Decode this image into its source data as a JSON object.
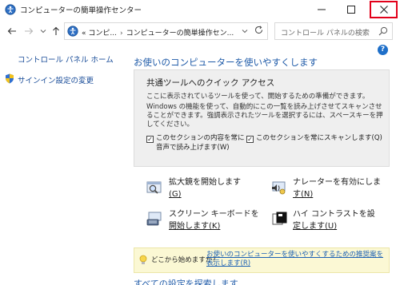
{
  "window": {
    "title": "コンピューターの簡単操作センター",
    "minimize_glyph": "—",
    "close_glyph": "✕"
  },
  "address": {
    "overflow": "«",
    "crumb1": "コンピ...",
    "crumb2": "コンピューターの簡単操作セン..."
  },
  "search": {
    "placeholder": "コントロール パネルの検索"
  },
  "sidebar": {
    "home": "コントロール パネル ホーム",
    "signin": "サインイン設定の変更"
  },
  "main": {
    "heading": "お使いのコンピューターを使いやすくします",
    "help": "?"
  },
  "quick_access": {
    "title": "共通ツールへのクイック アクセス",
    "subtitle": "ここに表示されているツールを使って、開始するための準備ができます。",
    "description": "Windows の機能を使って、自動的にこの一覧を読み上げさせてスキャンさせることができます。強調表示されたツールを選択するには、スペースキーを押してください。",
    "checkbox1": "このセクションの内容を常に音声で読み上げます(W)",
    "checkbox1_checked": true,
    "checkbox2": "このセクションを常にスキャンします(Q)",
    "checkbox2_checked": true,
    "check_glyph": "✓"
  },
  "tools": {
    "magnifier_a": "拡大鏡を開始します",
    "magnifier_b": "(G)",
    "narrator_a": "ナレーターを有効にしま",
    "narrator_b": "す(N)",
    "osk_a": "スクリーン キーボードを",
    "osk_b": "開始します(K)",
    "contrast_a": "ハイ コントラストを設",
    "contrast_b": "定します(U)"
  },
  "tip": {
    "question": "どこから始めますか?",
    "link": "お使いのコンピューターを使いやすくするための推奨案を表示します(R)"
  },
  "bottom": {
    "link": "すべての設定を探索します"
  }
}
